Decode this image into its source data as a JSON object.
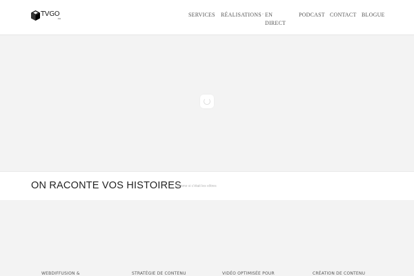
{
  "header": {
    "logo": {
      "text": "TVGO",
      "subtext": ".CA",
      "icon": "cube-icon"
    },
    "nav": [
      {
        "label": "Services"
      },
      {
        "label": "Réalisations",
        "has_dropdown": true
      },
      {
        "label": "En direct"
      },
      {
        "label": "Podcast"
      },
      {
        "label": "Contact"
      },
      {
        "label": "Blogue"
      }
    ]
  },
  "hero": {
    "loader_icon": "spinner-icon"
  },
  "tagline": {
    "title": "ON RACONTE VOS HISTOIRES",
    "subtitle": "Comme si c'était les vôtres"
  },
  "services": [
    {
      "label": "Webdiffusion &"
    },
    {
      "label": "Stratégie de contenu"
    },
    {
      "label": "Vidéo optimisée pour"
    },
    {
      "label": "Création de contenu"
    }
  ],
  "colors": {
    "header_bg": "#ffffff",
    "page_bg": "#f3f3f3",
    "text_dark": "#222222",
    "nav_text": "#555555"
  }
}
